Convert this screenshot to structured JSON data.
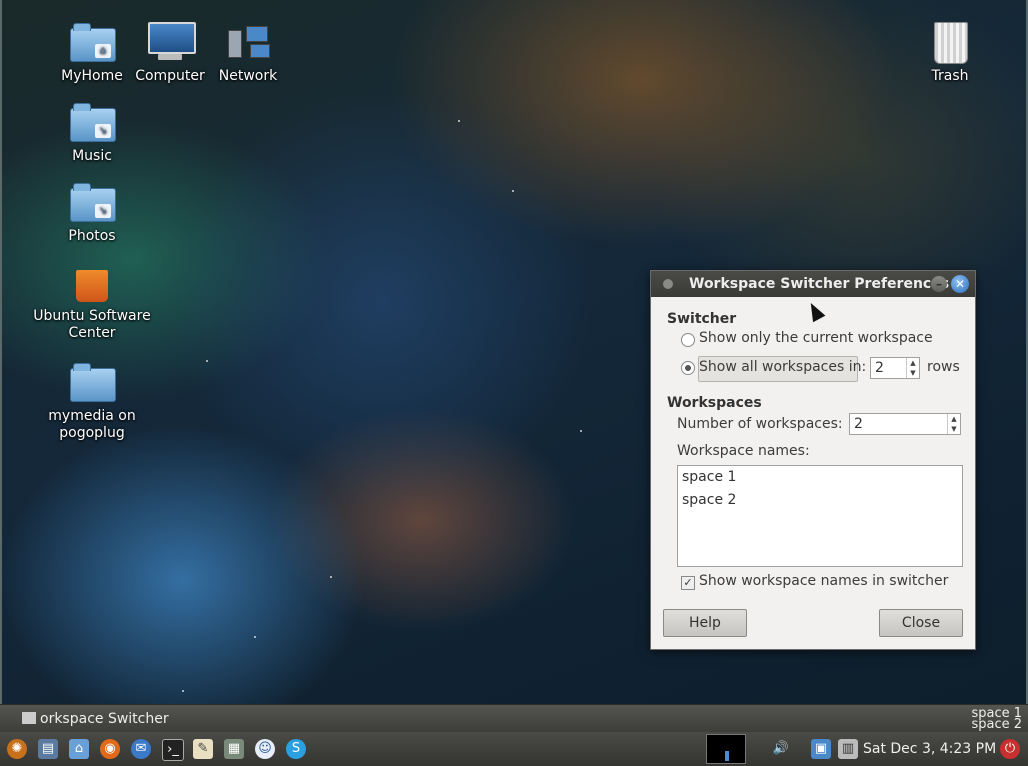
{
  "desktop": {
    "icons": [
      {
        "label": "MyHome"
      },
      {
        "label": "Computer"
      },
      {
        "label": "Network"
      },
      {
        "label": "Trash"
      },
      {
        "label": "Music"
      },
      {
        "label": "Photos"
      },
      {
        "label": "Ubuntu Software Center"
      },
      {
        "label": "mymedia on pogoplug"
      }
    ]
  },
  "dialog": {
    "title": "Workspace Switcher Preferences",
    "switcher": {
      "heading": "Switcher",
      "option_current": "Show only the current workspace",
      "option_all": "Show all workspaces in:",
      "rows_value": "2",
      "rows_label": "rows",
      "selected": "all"
    },
    "workspaces": {
      "heading": "Workspaces",
      "count_label": "Number of workspaces:",
      "count_value": "2",
      "names_label": "Workspace names:",
      "names": [
        "space 1",
        "space 2"
      ],
      "show_names_label": "Show workspace names in switcher",
      "show_names_checked": true
    },
    "buttons": {
      "help": "Help",
      "close": "Close"
    }
  },
  "taskbar": {
    "task_title": "orkspace Switcher Pref...",
    "workspace_labels": [
      "space 1",
      "space 2"
    ]
  },
  "panel": {
    "clock": "Sat Dec  3,  4:23 PM",
    "launchers": [
      "ubuntu-menu-icon",
      "show-desktop-icon",
      "home-folder-icon",
      "firefox-icon",
      "thunderbird-icon",
      "terminal-icon",
      "text-editor-icon",
      "calculator-icon",
      "chat-icon",
      "skype-icon"
    ]
  }
}
